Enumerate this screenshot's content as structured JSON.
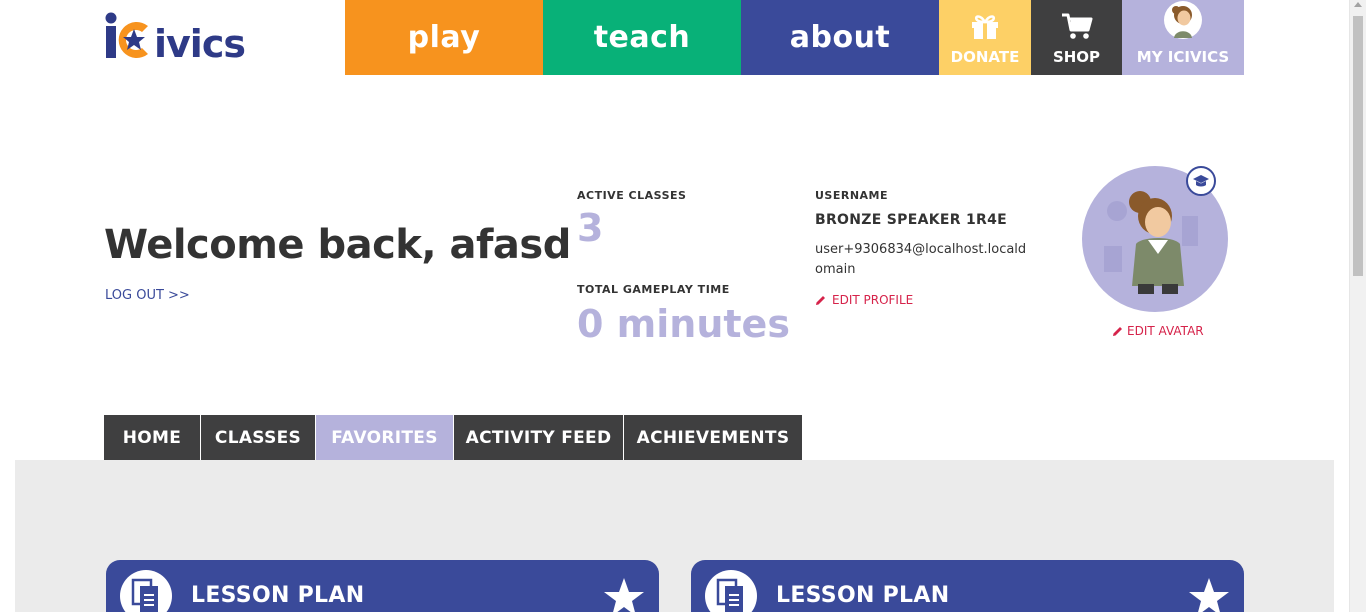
{
  "header": {
    "logo_text": "iCivics",
    "nav": {
      "play": "play",
      "teach": "teach",
      "about": "about",
      "donate": "DONATE",
      "shop": "SHOP",
      "my_icivics": "MY ICIVICS"
    }
  },
  "welcome": {
    "title": "Welcome back, afasd",
    "logout": "LOG OUT >>"
  },
  "stats": {
    "active_classes_label": "ACTIVE CLASSES",
    "active_classes_value": "3",
    "gameplay_label": "TOTAL GAMEPLAY TIME",
    "gameplay_value": "0 minutes"
  },
  "profile": {
    "username_label": "USERNAME",
    "username": "BRONZE SPEAKER 1R4E",
    "email": "user+9306834@localhost.localdomain",
    "edit_profile": "EDIT PROFILE",
    "edit_avatar": "EDIT AVATAR"
  },
  "tabs": [
    {
      "label": "HOME"
    },
    {
      "label": "CLASSES"
    },
    {
      "label": "FAVORITES"
    },
    {
      "label": "ACTIVITY FEED"
    },
    {
      "label": "ACHIEVEMENTS"
    }
  ],
  "cards": [
    {
      "title": "LESSON PLAN"
    },
    {
      "title": "LESSON PLAN"
    }
  ],
  "colors": {
    "play": "#f7931e",
    "teach": "#08b178",
    "about": "#3a4a9a",
    "donate": "#fdd066",
    "shop": "#3f3f40",
    "my_icivics": "#b5b2dc",
    "accent_red": "#d6234a"
  }
}
